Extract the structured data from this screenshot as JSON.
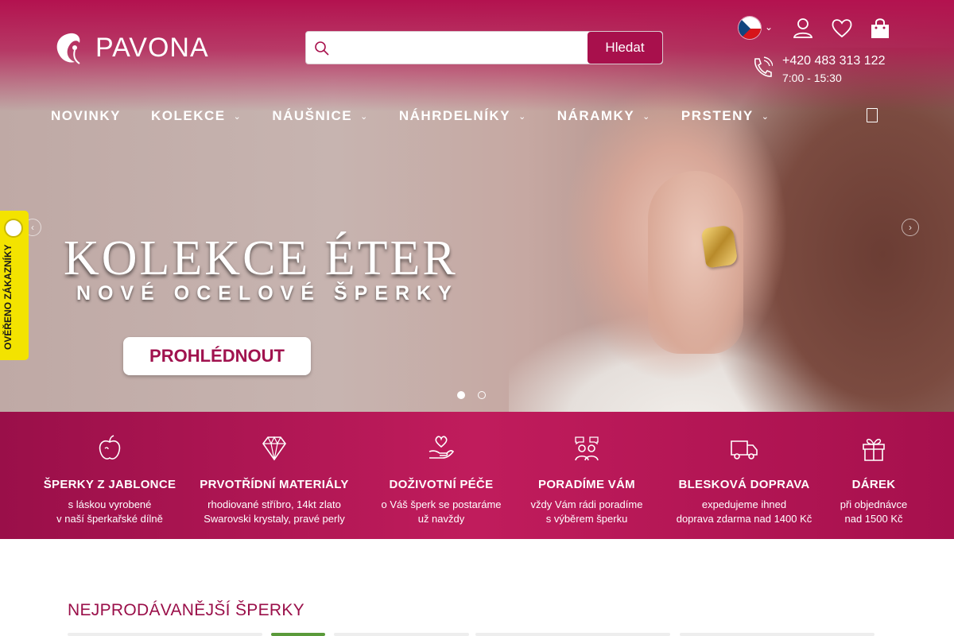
{
  "brand": {
    "name": "PAVONA"
  },
  "search": {
    "placeholder": "",
    "button_label": "Hledat"
  },
  "header": {
    "language": "cs",
    "phone": "+420 483 313 122",
    "hours": "7:00 - 15:30",
    "icons": [
      "czech-flag-icon",
      "user-icon",
      "heart-icon",
      "shopping-bag-icon",
      "phone-icon"
    ]
  },
  "nav": {
    "items": [
      {
        "label": "NOVINKY",
        "has_dropdown": false
      },
      {
        "label": "KOLEKCE",
        "has_dropdown": true
      },
      {
        "label": "NÁUŠNICE",
        "has_dropdown": true
      },
      {
        "label": "NÁHRDELNÍKY",
        "has_dropdown": true
      },
      {
        "label": "NÁRAMKY",
        "has_dropdown": true
      },
      {
        "label": "PRSTENY",
        "has_dropdown": true
      }
    ]
  },
  "hero": {
    "title": "KOLEKCE ÉTER",
    "subtitle": "NOVÉ OCELOVÉ ŠPERKY",
    "cta": "PROHLÉDNOUT",
    "slides": 2,
    "active_slide": 1
  },
  "badge": {
    "text": "OVĚŘENO ZÁKAZNÍKY"
  },
  "usp": [
    {
      "icon": "apple-icon",
      "title": "ŠPERKY Z JABLONCE",
      "line1": "s láskou vyrobené",
      "line2": "v naší šperkařské dílně"
    },
    {
      "icon": "diamond-icon",
      "title": "PRVOTŘÍDNÍ MATERIÁLY",
      "line1": "rhodiované stříbro, 14kt zlato",
      "line2": "Swarovski krystaly, pravé perly"
    },
    {
      "icon": "hand-heart-icon",
      "title": "DOŽIVOTNÍ PÉČE",
      "line1": "o Váš šperk se postaráme",
      "line2": "už navždy"
    },
    {
      "icon": "people-chat-icon",
      "title": "PORADÍME VÁM",
      "line1": "vždy Vám rádi poradíme",
      "line2": "s výběrem šperku"
    },
    {
      "icon": "truck-icon",
      "title": "BLESKOVÁ DOPRAVA",
      "line1": "expedujeme ihned",
      "line2": "doprava zdarma nad 1400 Kč"
    },
    {
      "icon": "gift-icon",
      "title": "DÁREK",
      "line1": "při objednávce",
      "line2": "nad 1500 Kč"
    }
  ],
  "section": {
    "title": "NEJPRODÁVANĚJŠÍ ŠPERKY"
  },
  "colors": {
    "brand": "#a8104c",
    "badge": "#f3e300",
    "text_on_brand": "#ffffff"
  }
}
